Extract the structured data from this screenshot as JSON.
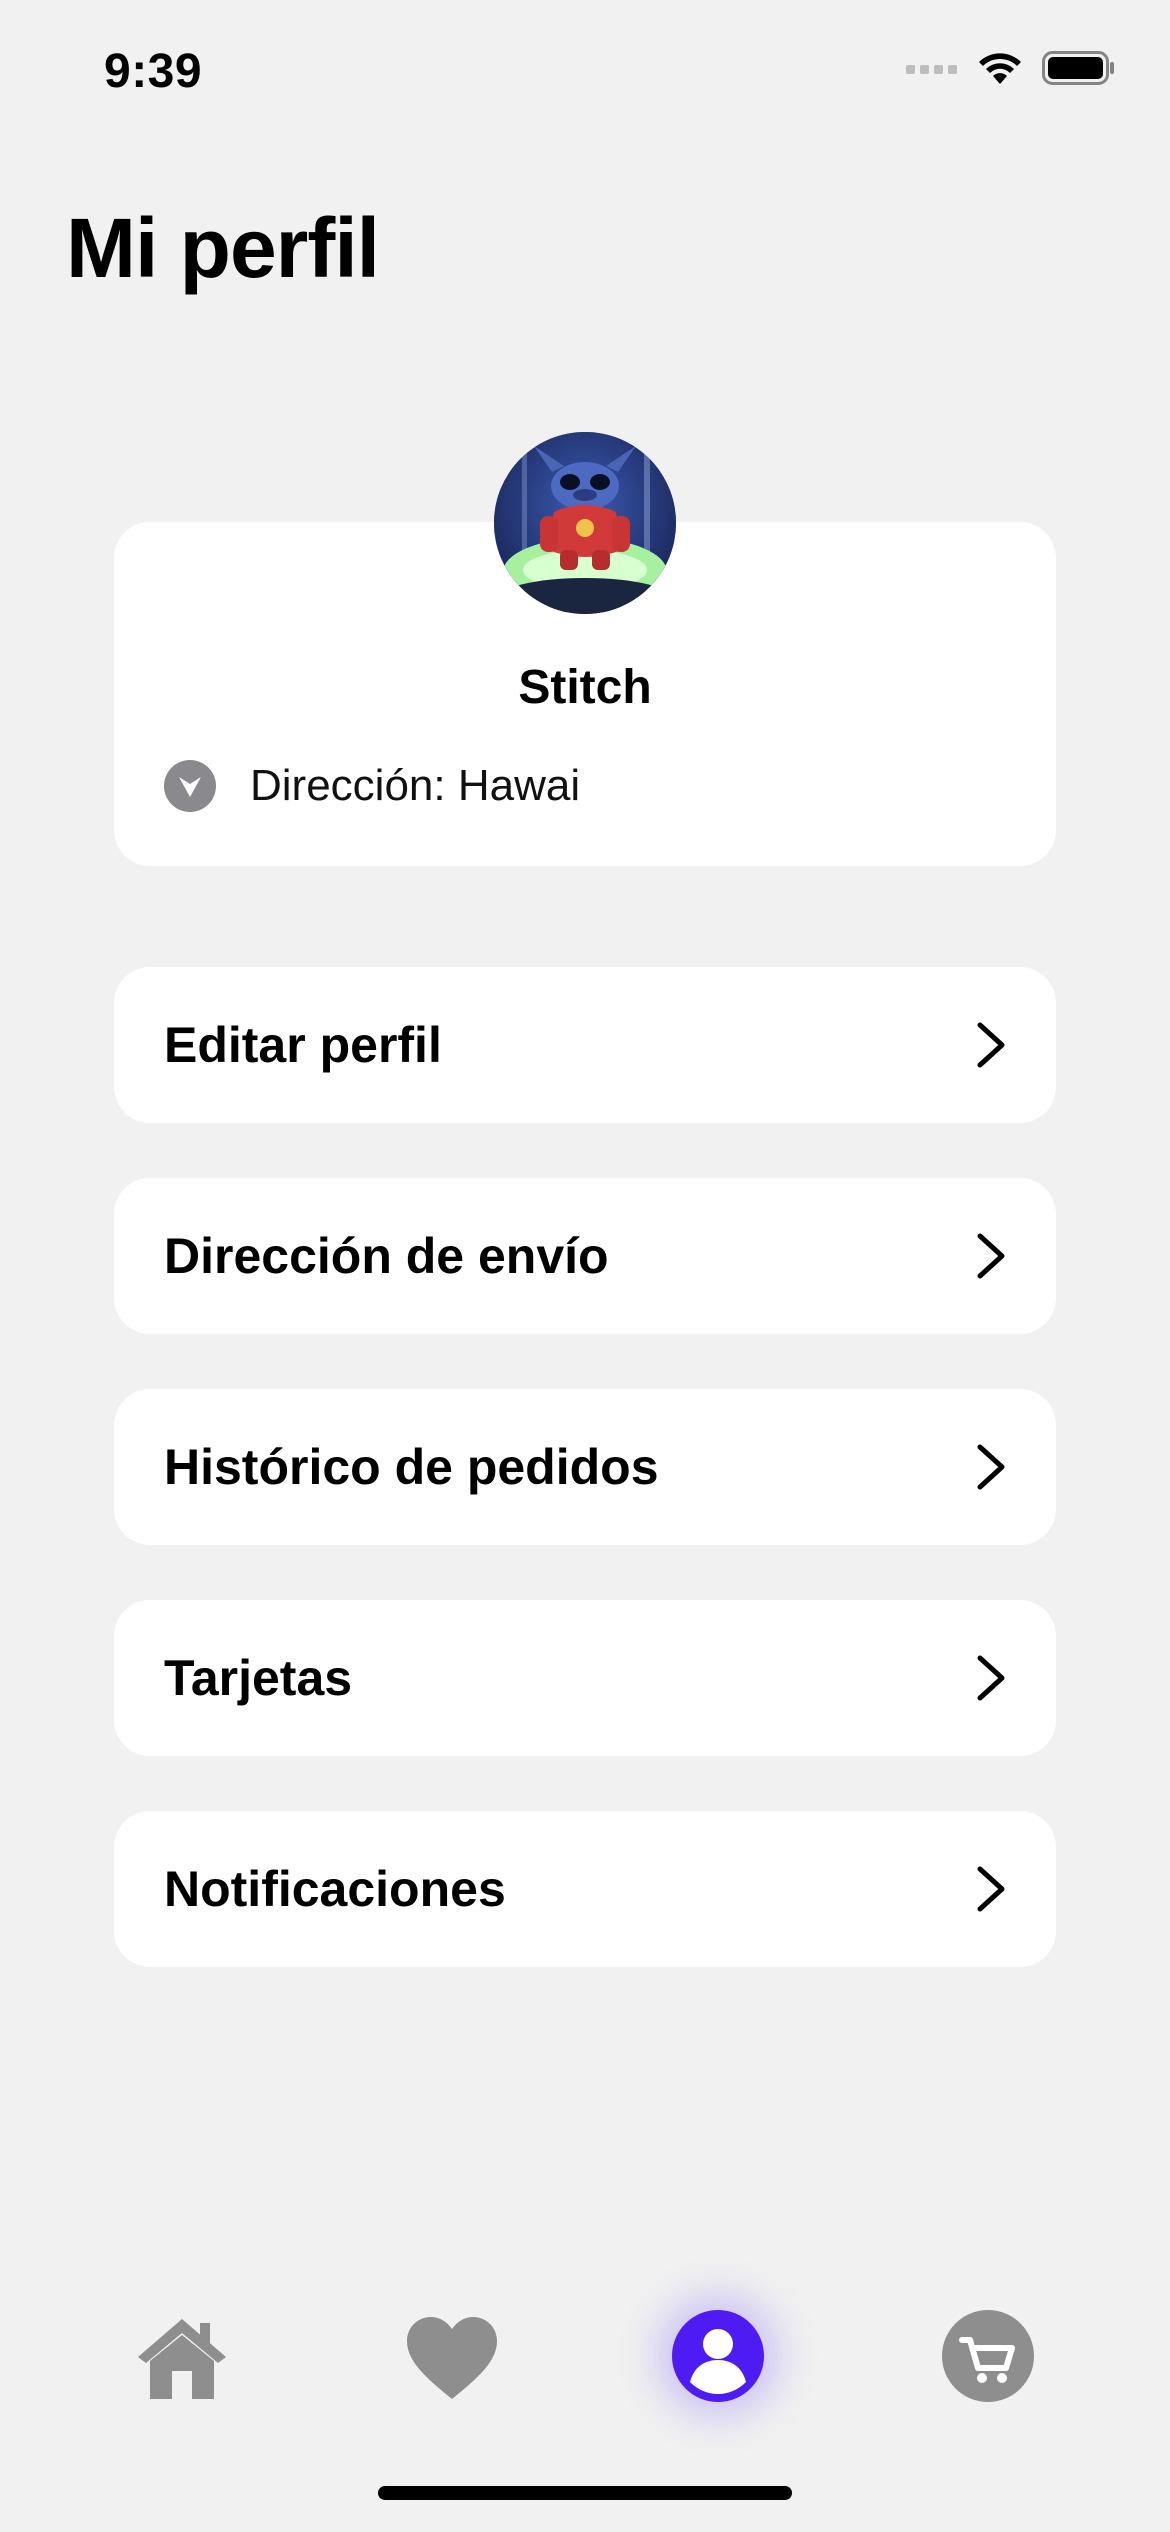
{
  "status_bar": {
    "time": "9:39"
  },
  "page": {
    "title": "Mi perfil"
  },
  "profile": {
    "name": "Stitch",
    "address": "Dirección: Hawai"
  },
  "menu": {
    "items": [
      {
        "label": "Editar perfil"
      },
      {
        "label": "Dirección de envío"
      },
      {
        "label": "Histórico de pedidos"
      },
      {
        "label": "Tarjetas"
      },
      {
        "label": "Notificaciones"
      }
    ]
  },
  "tab_bar": {
    "tabs": [
      {
        "icon": "home-icon",
        "active": false
      },
      {
        "icon": "heart-icon",
        "active": false
      },
      {
        "icon": "user-icon",
        "active": true
      },
      {
        "icon": "cart-icon",
        "active": false
      }
    ]
  },
  "colors": {
    "background": "#f1f1f1",
    "card": "#ffffff",
    "accent": "#4f1bf3",
    "inactive_icon": "#8e8e8e"
  }
}
